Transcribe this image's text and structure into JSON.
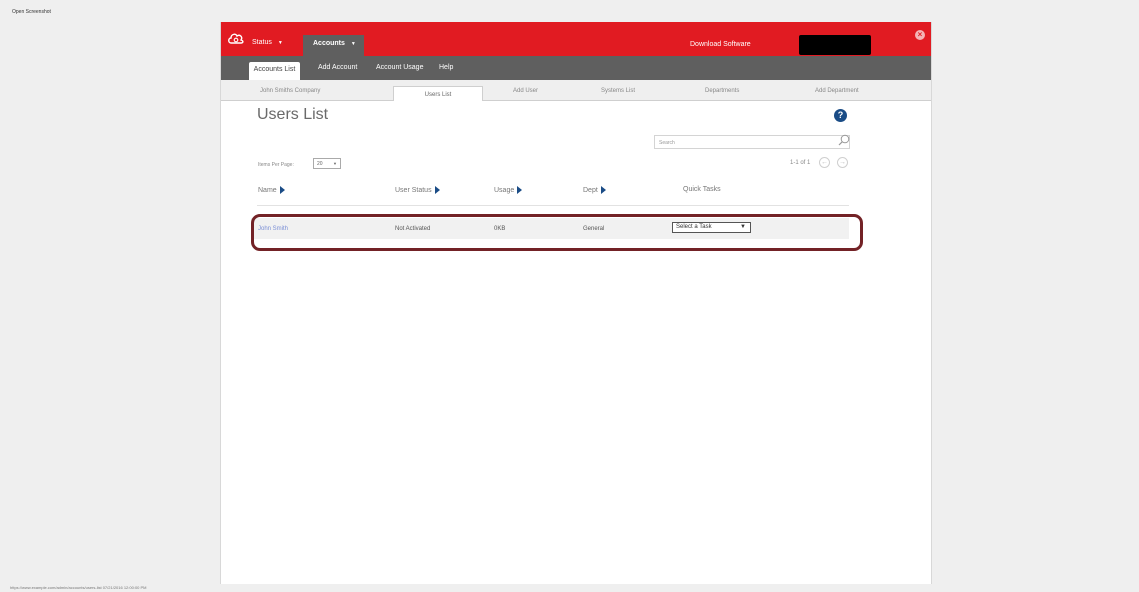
{
  "outer": {
    "label": "Open Screenshot",
    "footer": "https://www.example.com/admin/accounts/users-list 07/21/2016 12:00:00 PM"
  },
  "topbar": {
    "status_label": "Status",
    "accounts_label": "Accounts",
    "download_label": "Download Software",
    "close_symbol": "×",
    "brand_color": "#e11b22"
  },
  "subnav": {
    "items": [
      "Accounts List",
      "Add Account",
      "Account Usage",
      "Help"
    ],
    "active_index": 0
  },
  "tabs": {
    "items": [
      "John Smiths Company",
      "Users List",
      "Add User",
      "Systems List",
      "Departments",
      "Add Department"
    ],
    "active_index": 1
  },
  "page": {
    "title": "Users List",
    "help_symbol": "?",
    "search_placeholder": "Search",
    "items_per_page_label": "Items Per Page:",
    "items_per_page_value": "20",
    "pager_text": "1-1 of 1",
    "prev_symbol": "←",
    "next_symbol": "→"
  },
  "table": {
    "columns": [
      "Name",
      "User Status",
      "Usage",
      "Dept",
      "Quick Tasks"
    ],
    "rows": [
      {
        "name": "John Smith",
        "status": "Not Activated",
        "usage": "0KB",
        "dept": "General",
        "task": "Select a Task"
      }
    ]
  },
  "highlight_color": "#732226"
}
